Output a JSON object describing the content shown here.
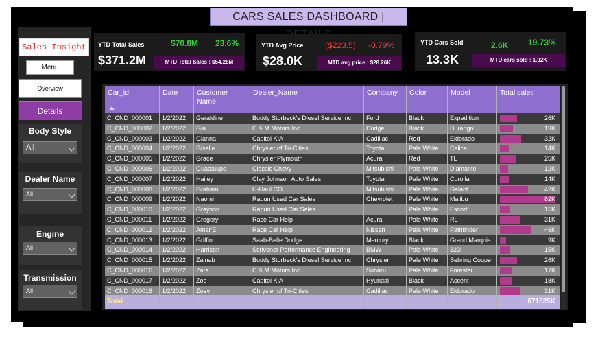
{
  "title": "CARS SALES DASHBOARD | DETAILS",
  "brand": "Sales Insight",
  "nav": {
    "menu": "Menu",
    "overview": "Overview",
    "details": "Details"
  },
  "filters": [
    {
      "label": "Body Style",
      "value": "All"
    },
    {
      "label": "Dealer Name",
      "value": "All"
    },
    {
      "label": "Engine",
      "value": "All"
    },
    {
      "label": "Transmission",
      "value": "All"
    }
  ],
  "kpis": {
    "total_sales": {
      "label": "YTD Total Sales",
      "value": "$371.2M",
      "delta": "$70.8M",
      "pct": "23.6%",
      "mtd": "MTD Total Sales : $54.28M"
    },
    "avg_price": {
      "label": "YTD Avg Price",
      "value": "$28.0K",
      "delta": "($223.5)",
      "pct": "-0.79%",
      "mtd": "MTD avg price : $28.26K"
    },
    "cars_sold": {
      "label": "YTD Cars Sold",
      "value": "13.3K",
      "delta": "2.6K",
      "pct": "19.73%",
      "mtd": "MTD cars sold : 1.92K"
    }
  },
  "table": {
    "columns": [
      "Car_id",
      "Date",
      "Customer Name",
      "Dealer_Name",
      "Company",
      "Color",
      "Model",
      "Total sales"
    ],
    "rows": [
      [
        "C_CND_000001",
        "1/2/2022",
        "Geraldine",
        "Buddy Storbeck's Diesel Service Inc",
        "Ford",
        "Black",
        "Expedition",
        "26K"
      ],
      [
        "C_CND_000002",
        "1/2/2022",
        "Gia",
        "C & M Motors Inc",
        "Dodge",
        "Black",
        "Durango",
        "19K"
      ],
      [
        "C_CND_000003",
        "1/2/2022",
        "Gianna",
        "Capitol KIA",
        "Cadillac",
        "Red",
        "Eldorado",
        "32K"
      ],
      [
        "C_CND_000004",
        "1/2/2022",
        "Giselle",
        "Chrysler of Tri-Cities",
        "Toyota",
        "Pale White",
        "Celica",
        "14K"
      ],
      [
        "C_CND_000005",
        "1/2/2022",
        "Grace",
        "Chrysler Plymouth",
        "Acura",
        "Red",
        "TL",
        "25K"
      ],
      [
        "C_CND_000006",
        "1/2/2022",
        "Guadalupe",
        "Classic Chevy",
        "Mitsubishi",
        "Pale White",
        "Diamante",
        "12K"
      ],
      [
        "C_CND_000007",
        "1/2/2022",
        "Hailey",
        "Clay Johnson Auto Sales",
        "Toyota",
        "Pale White",
        "Corolla",
        "14K"
      ],
      [
        "C_CND_000008",
        "1/2/2022",
        "Graham",
        "U-Haul CO",
        "Mitsubishi",
        "Pale White",
        "Galant",
        "42K"
      ],
      [
        "C_CND_000009",
        "1/2/2022",
        "Naomi",
        "Rabun Used Car Sales",
        "Chevrolet",
        "Pale White",
        "Malibu",
        "82K"
      ],
      [
        "C_CND_000010",
        "1/2/2022",
        "Grayson",
        "Rabun Used Car Sales",
        "Pale White",
        "Escort",
        "15K"
      ],
      [
        "C_CND_000011",
        "1/2/2022",
        "Gregory",
        "Race Car Help",
        "Acura",
        "Pale White",
        "RL",
        "31K"
      ],
      [
        "C_CND_000012",
        "1/2/2022",
        "Amar'E",
        "Race Car Help",
        "Nissan",
        "Pale White",
        "Pathfinder",
        "46K"
      ],
      [
        "C_CND_000013",
        "1/2/2022",
        "Griffin",
        "Saab-Belle Dodge",
        "Mercury",
        "Black",
        "Grand Marquis",
        "9K"
      ],
      [
        "C_CND_000014",
        "1/2/2022",
        "Harrison",
        "Scrivener Performance Engineering",
        "BMW",
        "Pale White",
        "323i",
        "15K"
      ],
      [
        "C_CND_000015",
        "1/2/2022",
        "Zainab",
        "Buddy Storbeck's Diesel Service Inc",
        "Chrysler",
        "Pale White",
        "Sebring Coupe",
        "26K"
      ],
      [
        "C_CND_000016",
        "1/2/2022",
        "Zara",
        "C & M Motors Inc",
        "Subaru",
        "Pale White",
        "Forester",
        "17K"
      ],
      [
        "C_CND_000017",
        "1/2/2022",
        "Zoe",
        "Capitol KIA",
        "Hyundai",
        "Black",
        "Accent",
        "18K"
      ],
      [
        "C_CND_000018",
        "1/2/2022",
        "Zoey",
        "Chrysler of Tri-Cities",
        "Cadillac",
        "Pale White",
        "Eldorado",
        "31K"
      ]
    ],
    "sales_k": [
      26,
      19,
      32,
      14,
      25,
      12,
      14,
      42,
      82,
      15,
      31,
      46,
      9,
      15,
      26,
      17,
      18,
      31
    ],
    "total_label": "Total",
    "total_value": "671525K"
  }
}
